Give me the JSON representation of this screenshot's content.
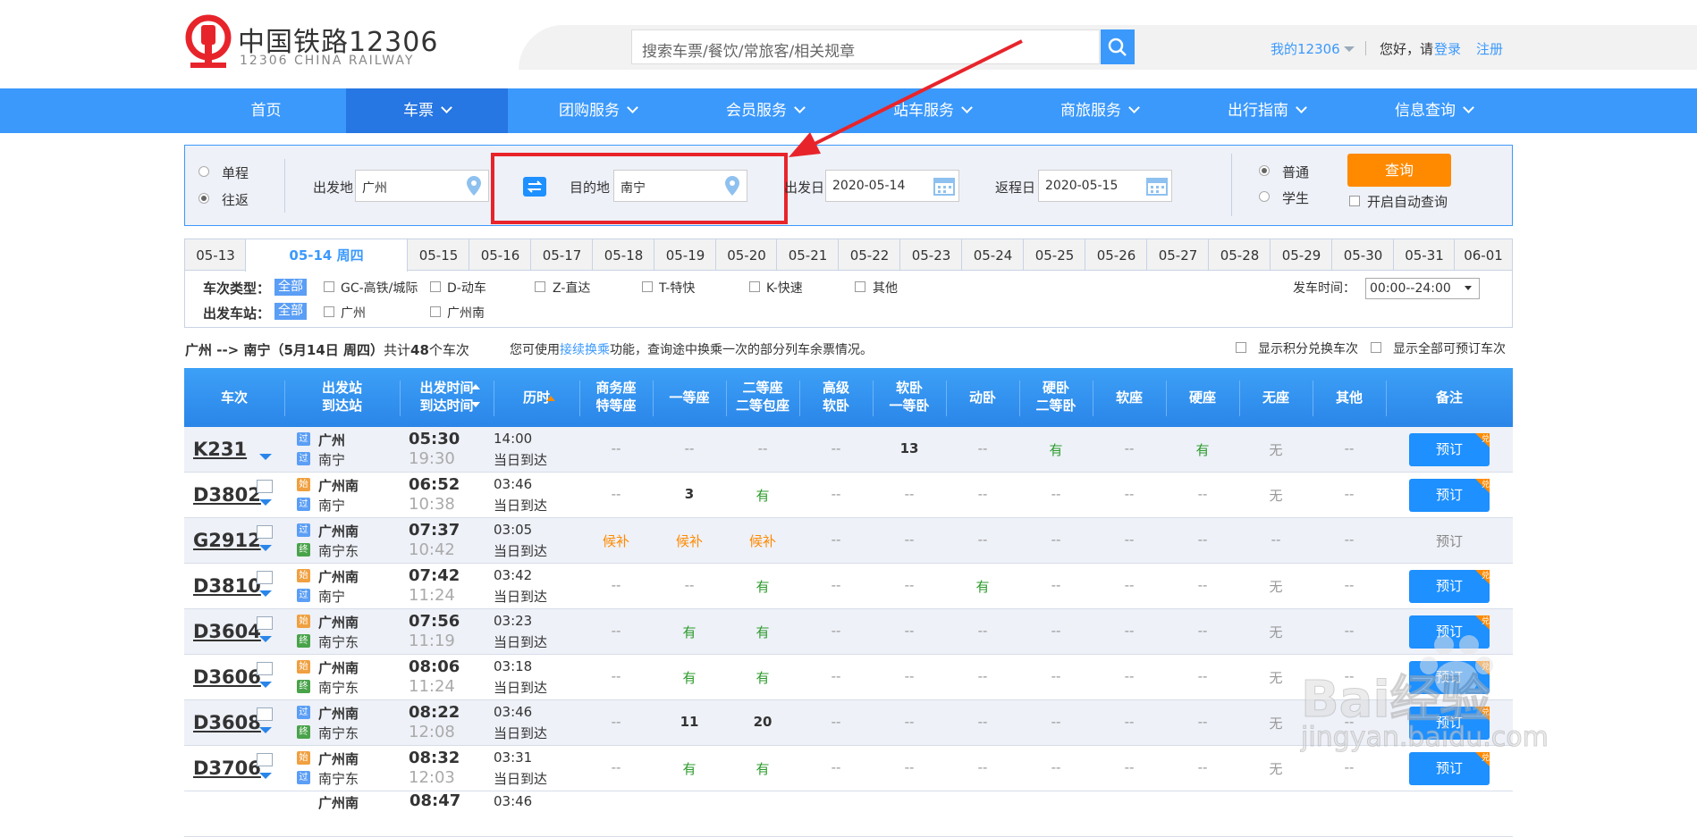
{
  "header": {
    "logo_title": "中国铁路12306",
    "logo_subtitle": "12306 CHINA RAILWAY",
    "search_placeholder": "搜索车票/餐饮/常旅客/相关规章",
    "my_account": "我的12306",
    "greeting": "您好，请",
    "login": "登录",
    "register": "注册"
  },
  "nav": [
    "首页",
    "车票",
    "团购服务",
    "会员服务",
    "站车服务",
    "商旅服务",
    "出行指南",
    "信息查询"
  ],
  "query": {
    "one_way": "单程",
    "round_trip": "往返",
    "from_label": "出发地",
    "from_value": "广州",
    "to_label": "目的地",
    "to_value": "南宁",
    "depart_label": "出发日",
    "depart_value": "2020-05-14",
    "return_label": "返程日",
    "return_value": "2020-05-15",
    "normal": "普通",
    "student": "学生",
    "query_button": "查询",
    "auto_query": "开启自动查询"
  },
  "dates": [
    "05-13",
    "05-14 周四",
    "05-15",
    "05-16",
    "05-17",
    "05-18",
    "05-19",
    "05-20",
    "05-21",
    "05-22",
    "05-23",
    "05-24",
    "05-25",
    "05-26",
    "05-27",
    "05-28",
    "05-29",
    "05-30",
    "05-31",
    "06-01"
  ],
  "filters": {
    "type_label": "车次类型：",
    "all": "全部",
    "types": [
      "GC-高铁/城际",
      "D-动车",
      "Z-直达",
      "T-特快",
      "K-快速",
      "其他"
    ],
    "station_label": "出发车站：",
    "stations": [
      "广州",
      "广州南"
    ],
    "time_label": "发车时间：",
    "time_value": "00:00--24:00"
  },
  "summary": {
    "route": "广州 --> 南宁（5月14日 周四）",
    "count_pre": "共计",
    "count": "48",
    "count_post": "个车次",
    "tip_pre": "您可使用",
    "tip_link": "接续换乘",
    "tip_post": "功能，查询途中换乘一次的部分列车余票情况。",
    "opt1": "显示积分兑换车次",
    "opt2": "显示全部可预订车次"
  },
  "table": {
    "headers": [
      [
        "车次"
      ],
      [
        "出发站",
        "到达站"
      ],
      [
        "出发时间",
        "到达时间"
      ],
      [
        "历时"
      ],
      [
        "商务座",
        "特等座"
      ],
      [
        "一等座"
      ],
      [
        "二等座",
        "二等包座"
      ],
      [
        "高级",
        "软卧"
      ],
      [
        "软卧",
        "一等卧"
      ],
      [
        "动卧"
      ],
      [
        "硬卧",
        "二等卧"
      ],
      [
        "软座"
      ],
      [
        "硬座"
      ],
      [
        "无座"
      ],
      [
        "其他"
      ],
      [
        "备注"
      ]
    ],
    "book_label": "预订",
    "corner_label": "兑",
    "rows": [
      {
        "no": "K231",
        "from": "广州",
        "to": "南宁",
        "fb": "过",
        "tb": "过",
        "dep": "05:30",
        "arr": "19:30",
        "dur": "14:00",
        "note": "当日到达",
        "seats": [
          "--",
          "--",
          "--",
          "--",
          "13",
          "--",
          "有",
          "--",
          "有",
          "无",
          "--"
        ],
        "bookable": true
      },
      {
        "no": "D3802",
        "from": "广州南",
        "to": "南宁",
        "fb": "始",
        "tb": "过",
        "dep": "06:52",
        "arr": "10:38",
        "dur": "03:46",
        "note": "当日到达",
        "seats": [
          "--",
          "3",
          "有",
          "--",
          "--",
          "--",
          "--",
          "--",
          "--",
          "无",
          "--"
        ],
        "bookable": true
      },
      {
        "no": "G2912",
        "from": "广州南",
        "to": "南宁东",
        "fb": "过",
        "tb": "终",
        "dep": "07:37",
        "arr": "10:42",
        "dur": "03:05",
        "note": "当日到达",
        "seats": [
          "候补",
          "候补",
          "候补",
          "--",
          "--",
          "--",
          "--",
          "--",
          "--",
          "--",
          "--"
        ],
        "bookable": false
      },
      {
        "no": "D3810",
        "from": "广州南",
        "to": "南宁",
        "fb": "始",
        "tb": "过",
        "dep": "07:42",
        "arr": "11:24",
        "dur": "03:42",
        "note": "当日到达",
        "seats": [
          "--",
          "--",
          "有",
          "--",
          "--",
          "有",
          "--",
          "--",
          "--",
          "无",
          "--"
        ],
        "bookable": true
      },
      {
        "no": "D3604",
        "from": "广州南",
        "to": "南宁东",
        "fb": "始",
        "tb": "终",
        "dep": "07:56",
        "arr": "11:19",
        "dur": "03:23",
        "note": "当日到达",
        "seats": [
          "--",
          "有",
          "有",
          "--",
          "--",
          "--",
          "--",
          "--",
          "--",
          "无",
          "--"
        ],
        "bookable": true
      },
      {
        "no": "D3606",
        "from": "广州南",
        "to": "南宁东",
        "fb": "始",
        "tb": "终",
        "dep": "08:06",
        "arr": "11:24",
        "dur": "03:18",
        "note": "当日到达",
        "seats": [
          "--",
          "有",
          "有",
          "--",
          "--",
          "--",
          "--",
          "--",
          "--",
          "无",
          "--"
        ],
        "bookable": true
      },
      {
        "no": "D3608",
        "from": "广州南",
        "to": "南宁东",
        "fb": "过",
        "tb": "终",
        "dep": "08:22",
        "arr": "12:08",
        "dur": "03:46",
        "note": "当日到达",
        "seats": [
          "--",
          "11",
          "20",
          "--",
          "--",
          "--",
          "--",
          "--",
          "--",
          "无",
          "--"
        ],
        "bookable": true
      },
      {
        "no": "D3706",
        "from": "广州南",
        "to": "南宁东",
        "fb": "始",
        "tb": "过",
        "dep": "08:32",
        "arr": "12:03",
        "dur": "03:31",
        "note": "当日到达",
        "seats": [
          "--",
          "有",
          "有",
          "--",
          "--",
          "--",
          "--",
          "--",
          "--",
          "无",
          "--"
        ],
        "bookable": true
      }
    ]
  },
  "partial_row": {
    "from": "广州南",
    "dep": "08:47",
    "dur": "03:46"
  },
  "watermark": {
    "text": "Bai经验",
    "url": "jingyan.baidu.com"
  },
  "colors": {
    "primary": "#3b99fc",
    "orange": "#ff8a00",
    "highlight": "#e8242b",
    "green": "#2b9a2b"
  }
}
